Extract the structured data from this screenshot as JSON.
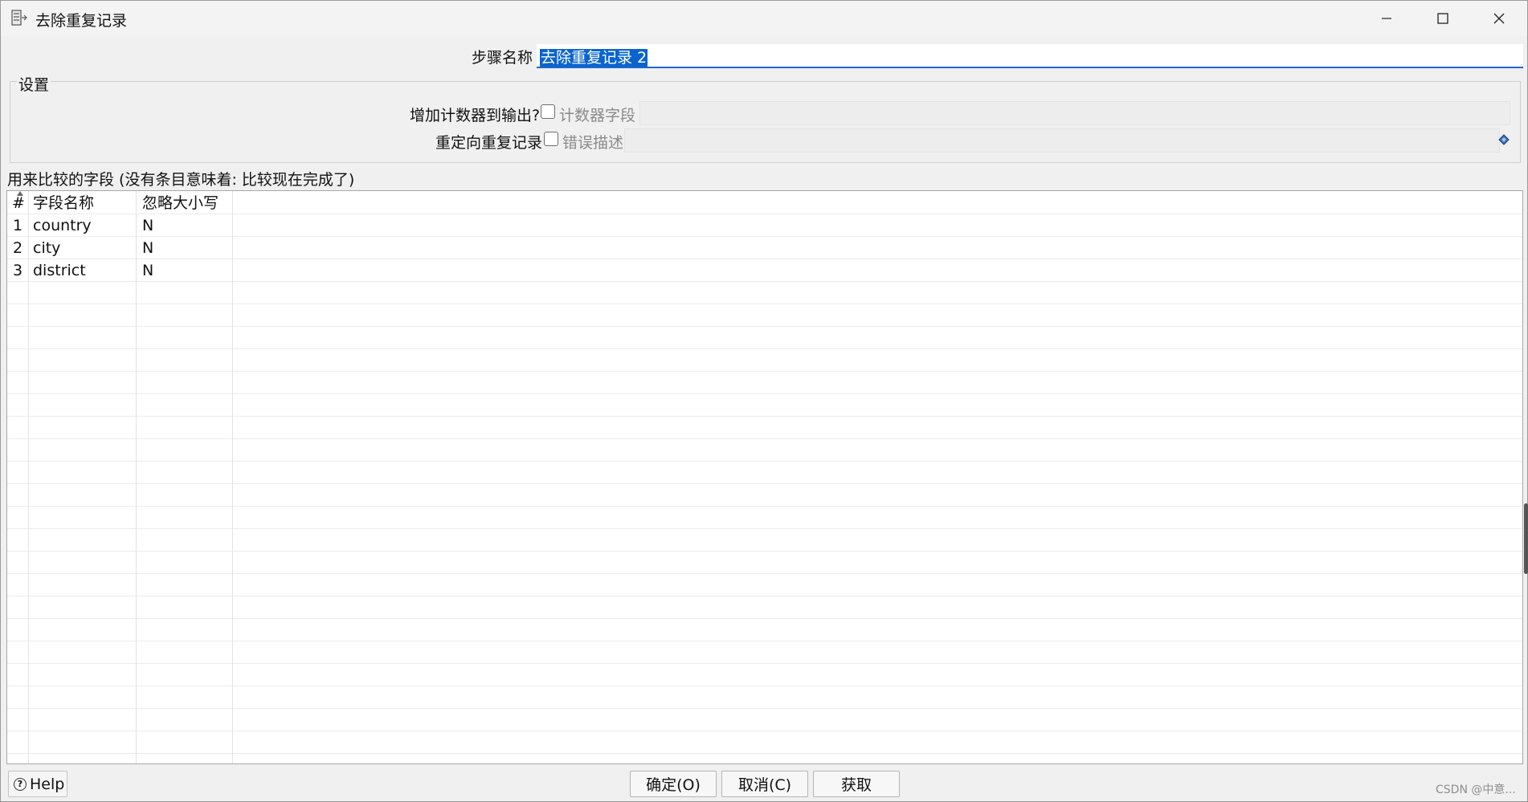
{
  "window": {
    "title": "去除重复记录"
  },
  "step": {
    "label": "步骤名称",
    "value": "去除重复记录 2"
  },
  "settings": {
    "legend": "设置",
    "counter_label": "增加计数器到输出?",
    "counter_field_label": "计数器字段",
    "redirect_label": "重定向重复记录",
    "error_desc_label": "错误描述"
  },
  "fields": {
    "caption": "用来比较的字段 (没有条目意味着: 比较现在完成了)",
    "columns": [
      "#",
      "字段名称",
      "忽略大小写"
    ],
    "rows": [
      {
        "num": "1",
        "name": "country",
        "ignore_case": "N"
      },
      {
        "num": "2",
        "name": "city",
        "ignore_case": "N"
      },
      {
        "num": "3",
        "name": "district",
        "ignore_case": "N"
      }
    ]
  },
  "buttons": {
    "help": "Help",
    "ok": "确定(O)",
    "cancel": "取消(C)",
    "get": "获取"
  },
  "watermark": "CSDN @中意...",
  "colors": {
    "selection": "#0a64d0",
    "focus_underline": "#1f67c9"
  }
}
